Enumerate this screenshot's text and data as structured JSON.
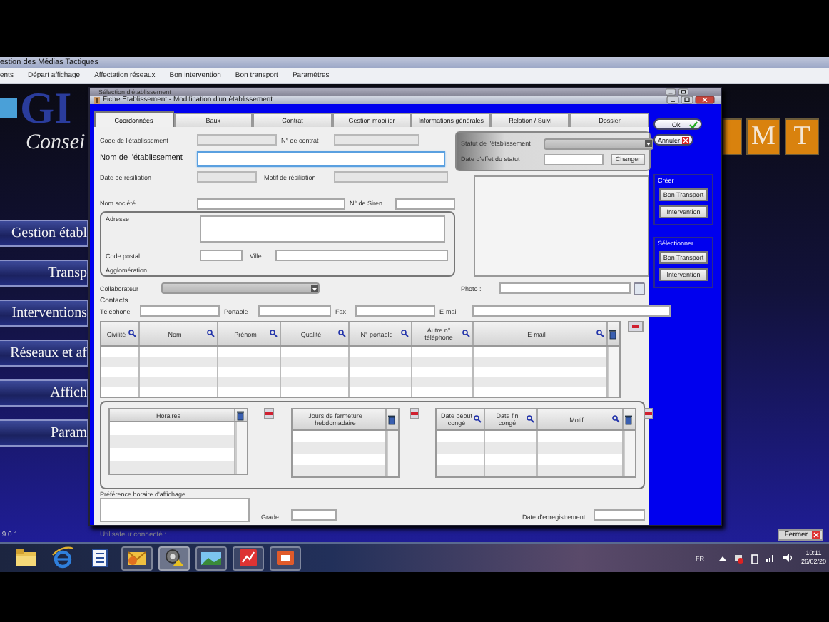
{
  "app": {
    "title": "estion des Médias Tactiques",
    "menu": [
      {
        "label": "ents"
      },
      {
        "label": "Départ affichage"
      },
      {
        "label": "Affectation réseaux"
      },
      {
        "label": "Bon intervention"
      },
      {
        "label": "Bon transport"
      },
      {
        "label": "Paramètres"
      }
    ],
    "logo": {
      "letters": "GI",
      "tagline": "Consei"
    },
    "nav": [
      {
        "label": "Gestion établ"
      },
      {
        "label": "Transp"
      },
      {
        "label": "Interventions"
      },
      {
        "label": "Réseaux et af"
      },
      {
        "label": "Affich"
      },
      {
        "label": "Param"
      }
    ],
    "tiles": [
      {
        "letter": "M"
      },
      {
        "letter": "T"
      }
    ],
    "version": ".9.0.1",
    "user_label": "Utilisateur connecté :",
    "close_button": "Fermer"
  },
  "dialog": {
    "behind_title": "Sélection d'établissement",
    "title": "Fiche Etablissement - Modification d'un établissement",
    "tabs": [
      {
        "label": "Coordonnées",
        "selected": true
      },
      {
        "label": "Baux",
        "selected": false
      },
      {
        "label": "Contrat",
        "selected": false
      },
      {
        "label": "Gestion mobilier",
        "selected": false
      },
      {
        "label": "Informations générales",
        "selected": false
      },
      {
        "label": "Relation / Suivi",
        "selected": false
      },
      {
        "label": "Dossier",
        "selected": false
      }
    ],
    "code": {
      "label": "Code de l'établissement",
      "disabled": true
    },
    "contract": {
      "label": "N° de contrat",
      "disabled": true
    },
    "name": {
      "label": "Nom de l'établissement",
      "focused": true
    },
    "termination_date": {
      "label": "Date de résiliation",
      "disabled": true
    },
    "termination_reason": {
      "label": "Motif de résiliation",
      "disabled": true
    },
    "company": {
      "label": "Nom société",
      "disabled": false
    },
    "siren": {
      "label": "N° de Siren",
      "disabled": false
    },
    "address": {
      "label": "Adresse",
      "postcode": "Code postal",
      "city": "Ville",
      "agglomeration": "Agglomération"
    },
    "status": {
      "label": "Statut de l'établissement",
      "disabled": true,
      "date_label": "Date d'effet du statut",
      "change_button": "Changer"
    },
    "collaborator": {
      "label": "Collaborateur",
      "disabled": true
    },
    "photo": {
      "label": "Photo :"
    },
    "contacts": {
      "title": "Contacts",
      "fields": [
        {
          "label": "Téléphone"
        },
        {
          "label": "Portable"
        },
        {
          "label": "Fax"
        },
        {
          "label": "E-mail"
        }
      ],
      "columns": [
        {
          "label": "Civilité",
          "sortable": true
        },
        {
          "label": "Nom",
          "sortable": true
        },
        {
          "label": "Prénom",
          "sortable": true
        },
        {
          "label": "Qualité",
          "sortable": true
        },
        {
          "label": "N° portable",
          "sortable": true
        },
        {
          "label": "Autre n° téléphone",
          "sortable": true
        },
        {
          "label": "E-mail",
          "sortable": true
        }
      ]
    },
    "schedules": [
      {
        "columns": [
          {
            "label": "Horaires",
            "sortable": false
          }
        ]
      },
      {
        "columns": [
          {
            "label": "Jours de fermeture hebdomadaire",
            "sortable": false
          }
        ]
      },
      {
        "columns": [
          {
            "label": "Date début congé",
            "sortable": true
          },
          {
            "label": "Date fin congé",
            "sortable": true
          },
          {
            "label": "Motif",
            "sortable": true
          }
        ]
      }
    ],
    "preference": {
      "label": "Préférence horaire d'affichage"
    },
    "grade": {
      "label": "Grade"
    },
    "registration": {
      "label": "Date d'enregistrement"
    },
    "ok_button": "Ok",
    "cancel_button": "Annuler",
    "groups": [
      {
        "title": "Créer",
        "buttons": [
          "Bon Transport",
          "Intervention"
        ]
      },
      {
        "title": "Sélectionner",
        "buttons": [
          "Bon Transport",
          "Intervention"
        ]
      }
    ]
  },
  "taskbar": {
    "language": "FR",
    "time": "10:11",
    "date": "26/02/20"
  }
}
